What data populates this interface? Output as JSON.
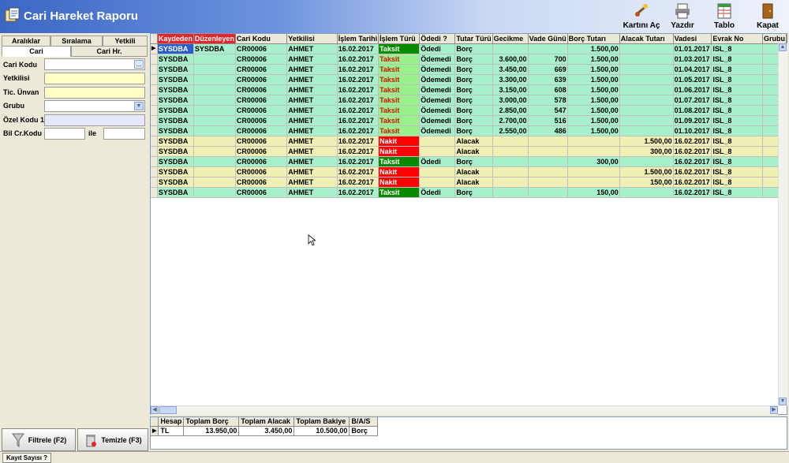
{
  "app": {
    "title": "Cari Hareket Raporu"
  },
  "toolbar": {
    "open_label": "Kartını Aç",
    "print_label": "Yazdır",
    "table_label": "Tablo",
    "close_label": "Kapat"
  },
  "leftpanel": {
    "tabs_top": [
      "Aralıklar",
      "Sıralama",
      "Yetkili"
    ],
    "tabs_bottom": [
      "Cari",
      "Cari Hr."
    ],
    "fields": {
      "cari_kodu": "Cari Kodu",
      "yetkilisi": "Yetkilisi",
      "tic_unvan": "Tic. Ünvan",
      "grubu": "Grubu",
      "ozel_kodu": "Özel Kodu 1",
      "bil_cr_kodu": "Bil Cr.Kodu",
      "ile": "ile"
    },
    "filter_label": "Filtrele (F2)",
    "clear_label": "Temizle (F3)"
  },
  "grid": {
    "columns": [
      "Kaydeden",
      "Düzenleyen",
      "Cari Kodu",
      "Yetkilisi",
      "İşlem Tarihi",
      "İşlem Türü",
      "Ödedi ?",
      "Tutar Türü",
      "Gecikme",
      "Vade Günü",
      "Borç Tutarı",
      "Alacak Tutarı",
      "Vadesi",
      "Evrak No",
      "Grubu"
    ],
    "rows": [
      {
        "c": [
          "SYSDBA",
          "SYSDBA",
          "CR00006",
          "AHMET",
          "16.02.2017",
          "Taksit",
          "Ödedi",
          "Borç",
          "",
          "",
          "1.500,00",
          "",
          "01.01.2017",
          "ISL_8",
          ""
        ],
        "color": "green",
        "tur": "taksit"
      },
      {
        "c": [
          "SYSDBA",
          "",
          "CR00006",
          "AHMET",
          "16.02.2017",
          "Taksit",
          "Ödemedi",
          "Borç",
          "3.600,00",
          "700",
          "1.500,00",
          "",
          "01.03.2017",
          "ISL_8",
          ""
        ],
        "color": "green",
        "tur": "taksitl"
      },
      {
        "c": [
          "SYSDBA",
          "",
          "CR00006",
          "AHMET",
          "16.02.2017",
          "Taksit",
          "Ödemedi",
          "Borç",
          "3.450,00",
          "669",
          "1.500,00",
          "",
          "01.04.2017",
          "ISL_8",
          ""
        ],
        "color": "green",
        "tur": "taksitl"
      },
      {
        "c": [
          "SYSDBA",
          "",
          "CR00006",
          "AHMET",
          "16.02.2017",
          "Taksit",
          "Ödemedi",
          "Borç",
          "3.300,00",
          "639",
          "1.500,00",
          "",
          "01.05.2017",
          "ISL_8",
          ""
        ],
        "color": "green",
        "tur": "taksitl"
      },
      {
        "c": [
          "SYSDBA",
          "",
          "CR00006",
          "AHMET",
          "16.02.2017",
          "Taksit",
          "Ödemedi",
          "Borç",
          "3.150,00",
          "608",
          "1.500,00",
          "",
          "01.06.2017",
          "ISL_8",
          ""
        ],
        "color": "green",
        "tur": "taksitl"
      },
      {
        "c": [
          "SYSDBA",
          "",
          "CR00006",
          "AHMET",
          "16.02.2017",
          "Taksit",
          "Ödemedi",
          "Borç",
          "3.000,00",
          "578",
          "1.500,00",
          "",
          "01.07.2017",
          "ISL_8",
          ""
        ],
        "color": "green",
        "tur": "taksitl"
      },
      {
        "c": [
          "SYSDBA",
          "",
          "CR00006",
          "AHMET",
          "16.02.2017",
          "Taksit",
          "Ödemedi",
          "Borç",
          "2.850,00",
          "547",
          "1.500,00",
          "",
          "01.08.2017",
          "ISL_8",
          ""
        ],
        "color": "green",
        "tur": "taksitl"
      },
      {
        "c": [
          "SYSDBA",
          "",
          "CR00006",
          "AHMET",
          "16.02.2017",
          "Taksit",
          "Ödemedi",
          "Borç",
          "2.700,00",
          "516",
          "1.500,00",
          "",
          "01.09.2017",
          "ISL_8",
          ""
        ],
        "color": "green",
        "tur": "taksitl"
      },
      {
        "c": [
          "SYSDBA",
          "",
          "CR00006",
          "AHMET",
          "16.02.2017",
          "Taksit",
          "Ödemedi",
          "Borç",
          "2.550,00",
          "486",
          "1.500,00",
          "",
          "01.10.2017",
          "ISL_8",
          ""
        ],
        "color": "green",
        "tur": "taksitl"
      },
      {
        "c": [
          "SYSDBA",
          "",
          "CR00006",
          "AHMET",
          "16.02.2017",
          "Nakit",
          "",
          "Alacak",
          "",
          "",
          "",
          "1.500,00",
          "16.02.2017",
          "ISL_8",
          ""
        ],
        "color": "yellow",
        "tur": "nakit"
      },
      {
        "c": [
          "SYSDBA",
          "",
          "CR00006",
          "AHMET",
          "16.02.2017",
          "Nakit",
          "",
          "Alacak",
          "",
          "",
          "",
          "300,00",
          "16.02.2017",
          "ISL_8",
          ""
        ],
        "color": "yellow",
        "tur": "nakit"
      },
      {
        "c": [
          "SYSDBA",
          "",
          "CR00006",
          "AHMET",
          "16.02.2017",
          "Taksit",
          "Ödedi",
          "Borç",
          "",
          "",
          "300,00",
          "",
          "16.02.2017",
          "ISL_8",
          ""
        ],
        "color": "green",
        "tur": "taksit"
      },
      {
        "c": [
          "SYSDBA",
          "",
          "CR00006",
          "AHMET",
          "16.02.2017",
          "Nakit",
          "",
          "Alacak",
          "",
          "",
          "",
          "1.500,00",
          "16.02.2017",
          "ISL_8",
          ""
        ],
        "color": "yellow",
        "tur": "nakit"
      },
      {
        "c": [
          "SYSDBA",
          "",
          "CR00006",
          "AHMET",
          "16.02.2017",
          "Nakit",
          "",
          "Alacak",
          "",
          "",
          "",
          "150,00",
          "16.02.2017",
          "ISL_8",
          ""
        ],
        "color": "yellow",
        "tur": "nakit"
      },
      {
        "c": [
          "SYSDBA",
          "",
          "CR00006",
          "AHMET",
          "16.02.2017",
          "Taksit",
          "Ödedi",
          "Borç",
          "",
          "",
          "150,00",
          "",
          "16.02.2017",
          "ISL_8",
          ""
        ],
        "color": "green",
        "tur": "taksit"
      }
    ]
  },
  "summary": {
    "columns": [
      "Hesap",
      "Toplam Borç",
      "Toplam Alacak",
      "Toplam Bakiye",
      "B/A/S"
    ],
    "row": [
      "TL",
      "13.950,00",
      "3.450,00",
      "10.500,00",
      "Borç"
    ]
  },
  "status": {
    "record_count_label": "Kayıt Sayısı ?"
  },
  "colors": {
    "accent": "#3b67c4",
    "green_row": "#a8f0cc",
    "yellow_row": "#f0efb4",
    "nakit": "#ff0000",
    "taksit": "#0a8a00"
  }
}
